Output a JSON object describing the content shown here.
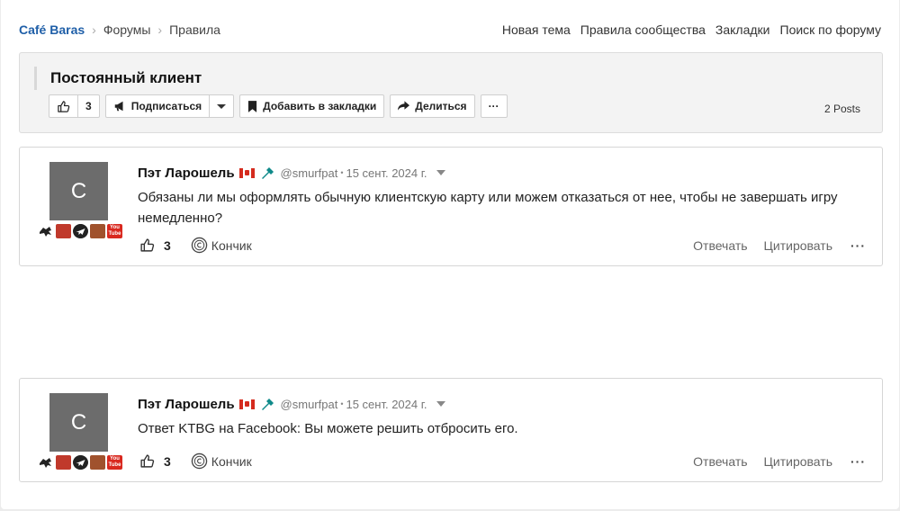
{
  "breadcrumb": {
    "brand": "Café Baras",
    "items": [
      "Форумы",
      "Правила"
    ]
  },
  "nav_links": [
    "Новая тема",
    "Правила сообщества",
    "Закладки",
    "Поиск по форуму"
  ],
  "topic": {
    "title": "Постоянный клиент",
    "like_count": "3",
    "subscribe_label": "Подписаться",
    "bookmark_label": "Добавить в закладки",
    "share_label": "Делиться",
    "more_label": "···",
    "posts_count": "2 Posts"
  },
  "posts": [
    {
      "avatar_letter": "C",
      "author": "Пэт Ларошель",
      "handle": "@smurfpat",
      "date": "15 сент. 2024 г.",
      "body": "Обязаны ли мы оформлять обычную клиентскую карту или можем отказаться от нее, чтобы не завершать игру немедленно?",
      "like_count": "3",
      "reaction_label": "Кончик",
      "reply_label": "Отвечать",
      "quote_label": "Цитировать",
      "more_label": "···"
    },
    {
      "avatar_letter": "C",
      "author": "Пэт Ларошель",
      "handle": "@smurfpat",
      "date": "15 сент. 2024 г.",
      "body": "Ответ KTBG на Facebook: Вы можете решить отбросить его.",
      "like_count": "3",
      "reaction_label": "Кончик",
      "reply_label": "Отвечать",
      "quote_label": "Цитировать",
      "more_label": "···"
    }
  ],
  "badge_youtube": [
    "You",
    "Tube"
  ],
  "colors": {
    "brand_link": "#1f5fa8",
    "panel_bg": "#f3f3f3",
    "avatar_bg": "#6c6c6c",
    "flag_red": "#d52b1e",
    "moderator_mark": "#0f8a8a"
  }
}
